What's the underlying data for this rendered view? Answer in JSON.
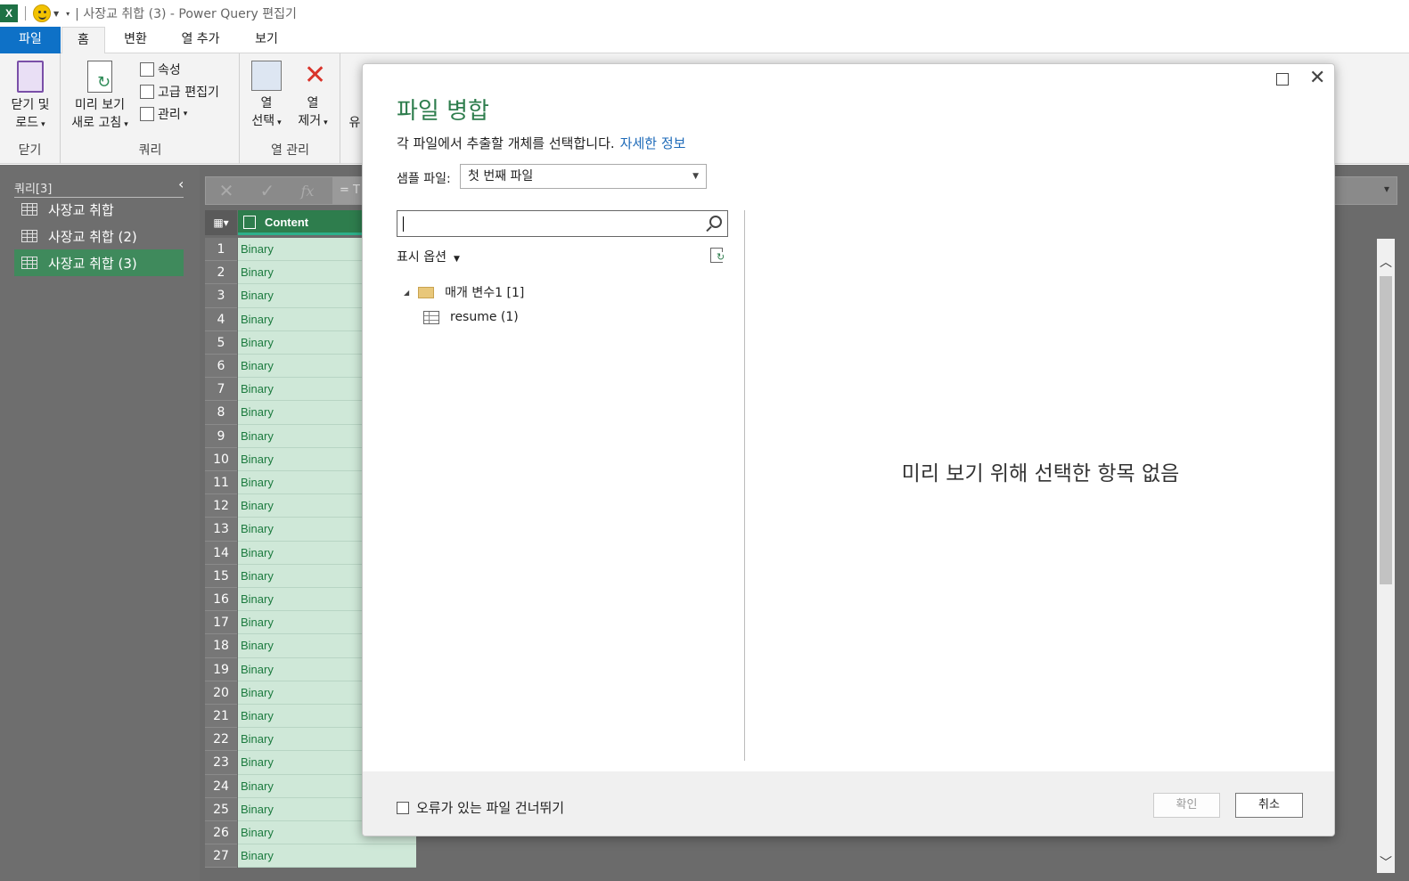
{
  "titlebar": {
    "app_icon": "excel-icon",
    "title": "| 사장교 취합 (3) - Power Query 편집기"
  },
  "tabs": [
    {
      "label": "파일"
    },
    {
      "label": "홈"
    },
    {
      "label": "변환"
    },
    {
      "label": "열 추가"
    },
    {
      "label": "보기"
    }
  ],
  "ribbon": {
    "close_load": {
      "line1": "닫기 및",
      "line2": "로드",
      "group": "닫기"
    },
    "query": {
      "refresh_line1": "미리 보기",
      "refresh_line2": "새로 고침",
      "properties": "속성",
      "advanced_editor": "고급 편집기",
      "manage": "관리",
      "group": "쿼리"
    },
    "columns": {
      "select_line1": "열",
      "select_line2": "선택",
      "remove_line1": "열",
      "remove_line2": "제거",
      "group": "열 관리",
      "partial": "유"
    }
  },
  "sidebar": {
    "header": "쿼리[3]",
    "items": [
      {
        "label": "사장교 취합",
        "selected": false
      },
      {
        "label": "사장교 취합 (2)",
        "selected": false
      },
      {
        "label": "사장교 취합 (3)",
        "selected": true
      }
    ]
  },
  "formula": {
    "prefix": "= T"
  },
  "table": {
    "column_header": "Content",
    "rows": [
      {
        "n": "1",
        "v": "Binary"
      },
      {
        "n": "2",
        "v": "Binary"
      },
      {
        "n": "3",
        "v": "Binary"
      },
      {
        "n": "4",
        "v": "Binary"
      },
      {
        "n": "5",
        "v": "Binary"
      },
      {
        "n": "6",
        "v": "Binary"
      },
      {
        "n": "7",
        "v": "Binary"
      },
      {
        "n": "8",
        "v": "Binary"
      },
      {
        "n": "9",
        "v": "Binary"
      },
      {
        "n": "10",
        "v": "Binary"
      },
      {
        "n": "11",
        "v": "Binary"
      },
      {
        "n": "12",
        "v": "Binary"
      },
      {
        "n": "13",
        "v": "Binary"
      },
      {
        "n": "14",
        "v": "Binary"
      },
      {
        "n": "15",
        "v": "Binary"
      },
      {
        "n": "16",
        "v": "Binary"
      },
      {
        "n": "17",
        "v": "Binary"
      },
      {
        "n": "18",
        "v": "Binary"
      },
      {
        "n": "19",
        "v": "Binary"
      },
      {
        "n": "20",
        "v": "Binary"
      },
      {
        "n": "21",
        "v": "Binary"
      },
      {
        "n": "22",
        "v": "Binary"
      },
      {
        "n": "23",
        "v": "Binary"
      },
      {
        "n": "24",
        "v": "Binary"
      },
      {
        "n": "25",
        "v": "Binary"
      },
      {
        "n": "26",
        "v": "Binary"
      },
      {
        "n": "27",
        "v": "Binary"
      }
    ]
  },
  "dialog": {
    "title": "파일 병합",
    "subtitle": "각 파일에서 추출할 개체를 선택합니다.",
    "learn_more": "자세한 정보",
    "sample_label": "샘플 파일:",
    "sample_value": "첫 번째 파일",
    "search_placeholder": "",
    "display_options": "표시 옵션",
    "tree": {
      "folder": "매개 변수1 [1]",
      "leaf": "resume (1)"
    },
    "preview_empty": "미리 보기 위해 선택한 항목 없음",
    "skip_errors": "오류가 있는 파일 건너뛰기",
    "ok": "확인",
    "cancel": "취소"
  },
  "colors": {
    "accent_green": "#2e7d4d",
    "file_tab_blue": "#0e71c7",
    "link_blue": "#1d6ab8"
  }
}
